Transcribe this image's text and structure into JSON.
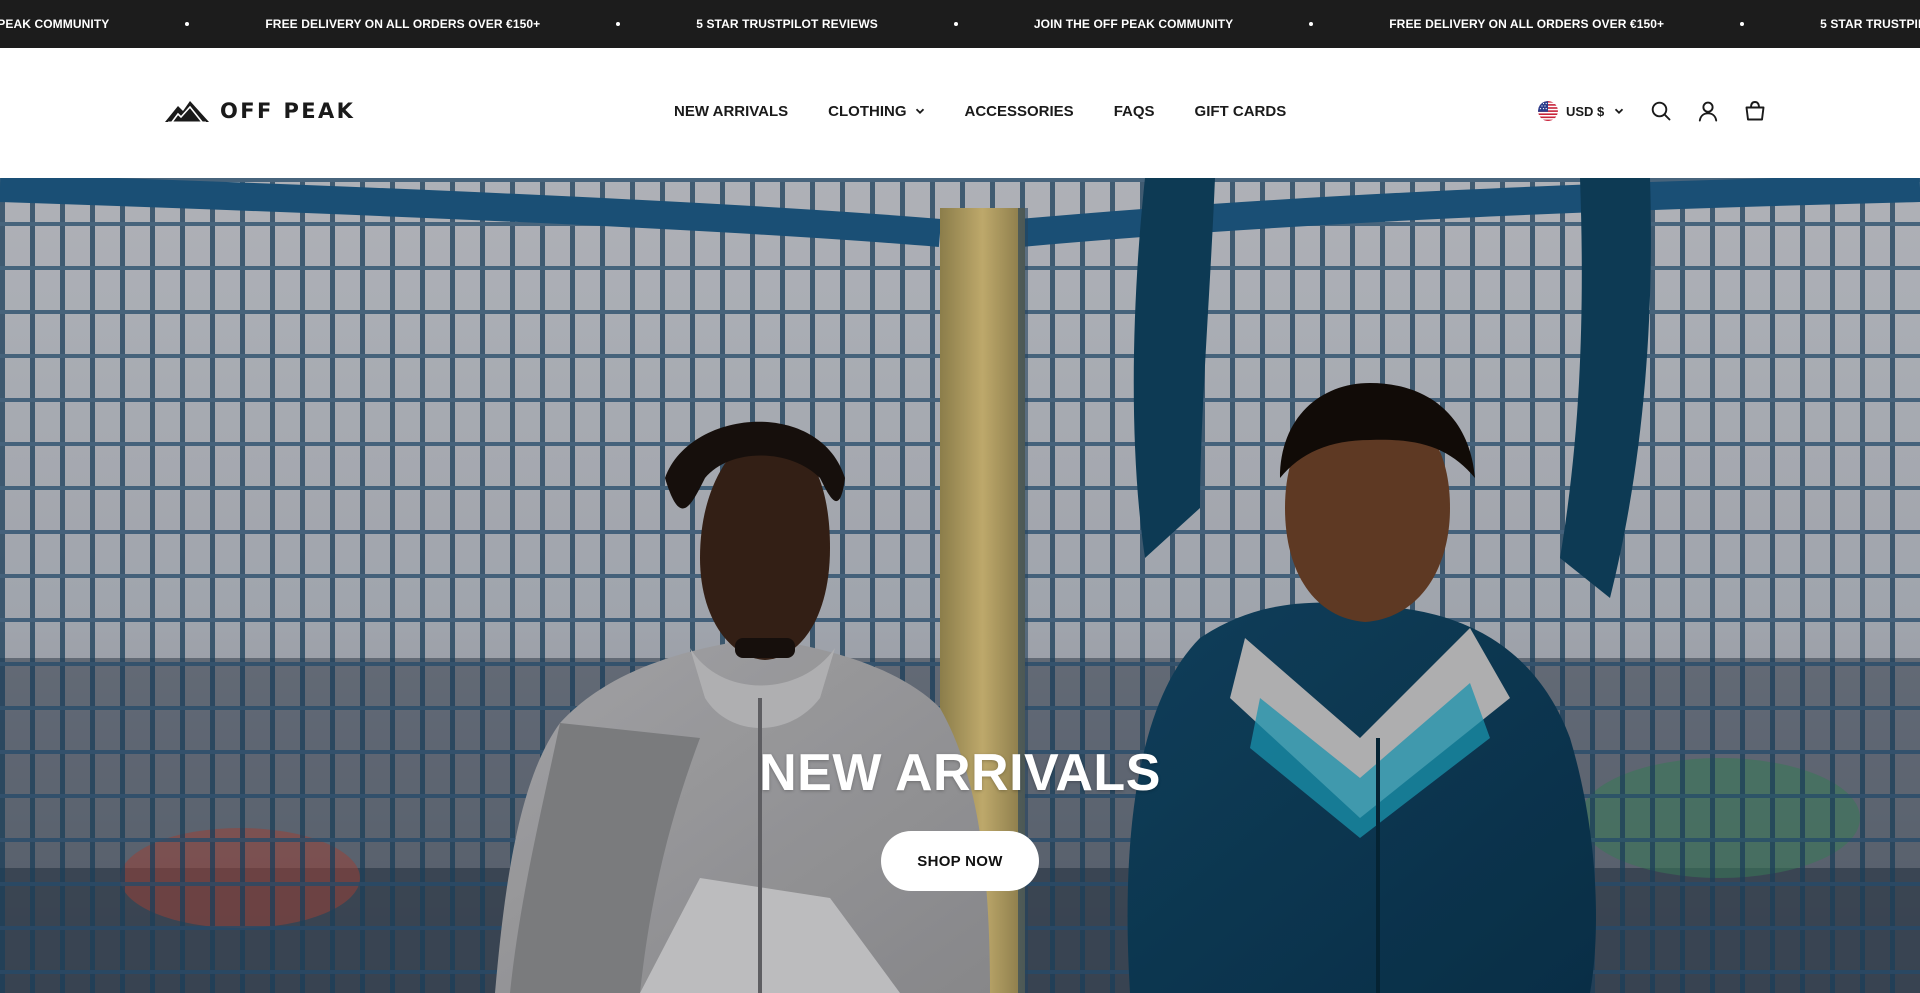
{
  "announcement": {
    "items": [
      "JOIN THE OFF PEAK COMMUNITY",
      "FREE DELIVERY ON ALL ORDERS OVER €150+",
      "5 STAR TRUSTPILOT REVIEWS",
      "JOIN THE OFF PEAK COMMUNITY",
      "FREE DELIVERY ON ALL ORDERS OVER €150+",
      "5 STAR TRUSTPILOT REVIEWS"
    ]
  },
  "header": {
    "logo_text": "OFF PEAK",
    "nav": [
      {
        "label": "NEW ARRIVALS",
        "has_dropdown": false
      },
      {
        "label": "CLOTHING",
        "has_dropdown": true
      },
      {
        "label": "ACCESSORIES",
        "has_dropdown": false
      },
      {
        "label": "FAQS",
        "has_dropdown": false
      },
      {
        "label": "GIFT CARDS",
        "has_dropdown": false
      }
    ],
    "currency": "USD $",
    "icons": [
      "us-flag-icon",
      "chevron-down-icon",
      "search-icon",
      "account-icon",
      "cart-icon"
    ]
  },
  "hero": {
    "title": "NEW ARRIVALS",
    "button_label": "SHOP NOW"
  },
  "colors": {
    "announcement_bg": "#1c1c1c",
    "header_bg": "#ffffff",
    "text_dark": "#1a1a1a",
    "button_bg": "#ffffff"
  }
}
